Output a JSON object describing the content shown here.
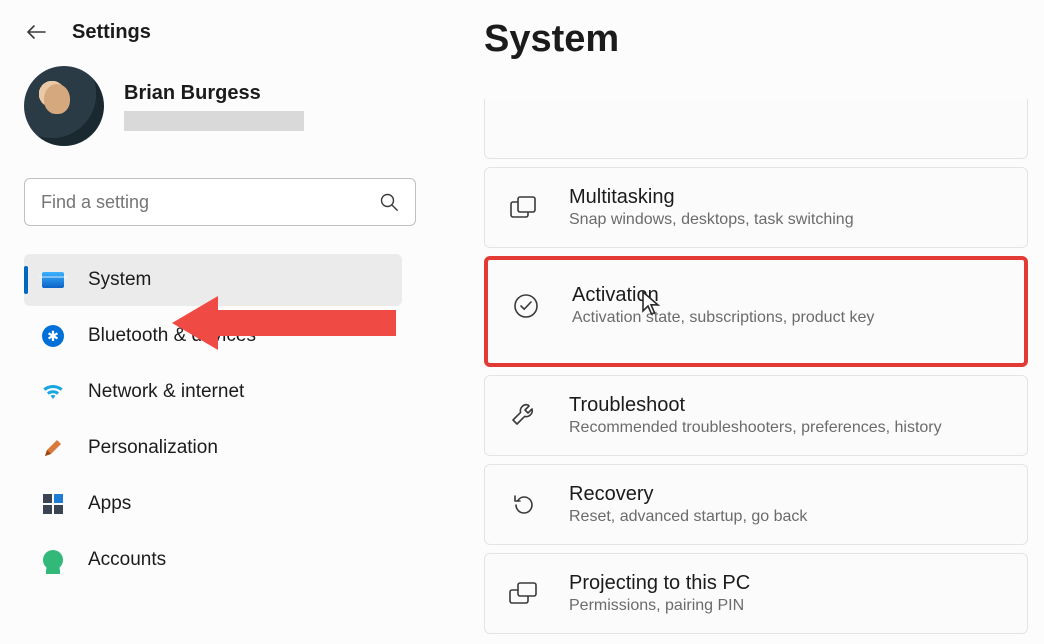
{
  "header": {
    "title": "Settings"
  },
  "account": {
    "name": "Brian Burgess"
  },
  "search": {
    "placeholder": "Find a setting"
  },
  "nav": {
    "items": [
      {
        "label": "System"
      },
      {
        "label": "Bluetooth & devices"
      },
      {
        "label": "Network & internet"
      },
      {
        "label": "Personalization"
      },
      {
        "label": "Apps"
      },
      {
        "label": "Accounts"
      }
    ]
  },
  "main": {
    "title": "System",
    "cards": [
      {
        "title": "Multitasking",
        "sub": "Snap windows, desktops, task switching"
      },
      {
        "title": "Activation",
        "sub": "Activation state, subscriptions, product key"
      },
      {
        "title": "Troubleshoot",
        "sub": "Recommended troubleshooters, preferences, history"
      },
      {
        "title": "Recovery",
        "sub": "Reset, advanced startup, go back"
      },
      {
        "title": "Projecting to this PC",
        "sub": "Permissions, pairing PIN"
      }
    ]
  }
}
